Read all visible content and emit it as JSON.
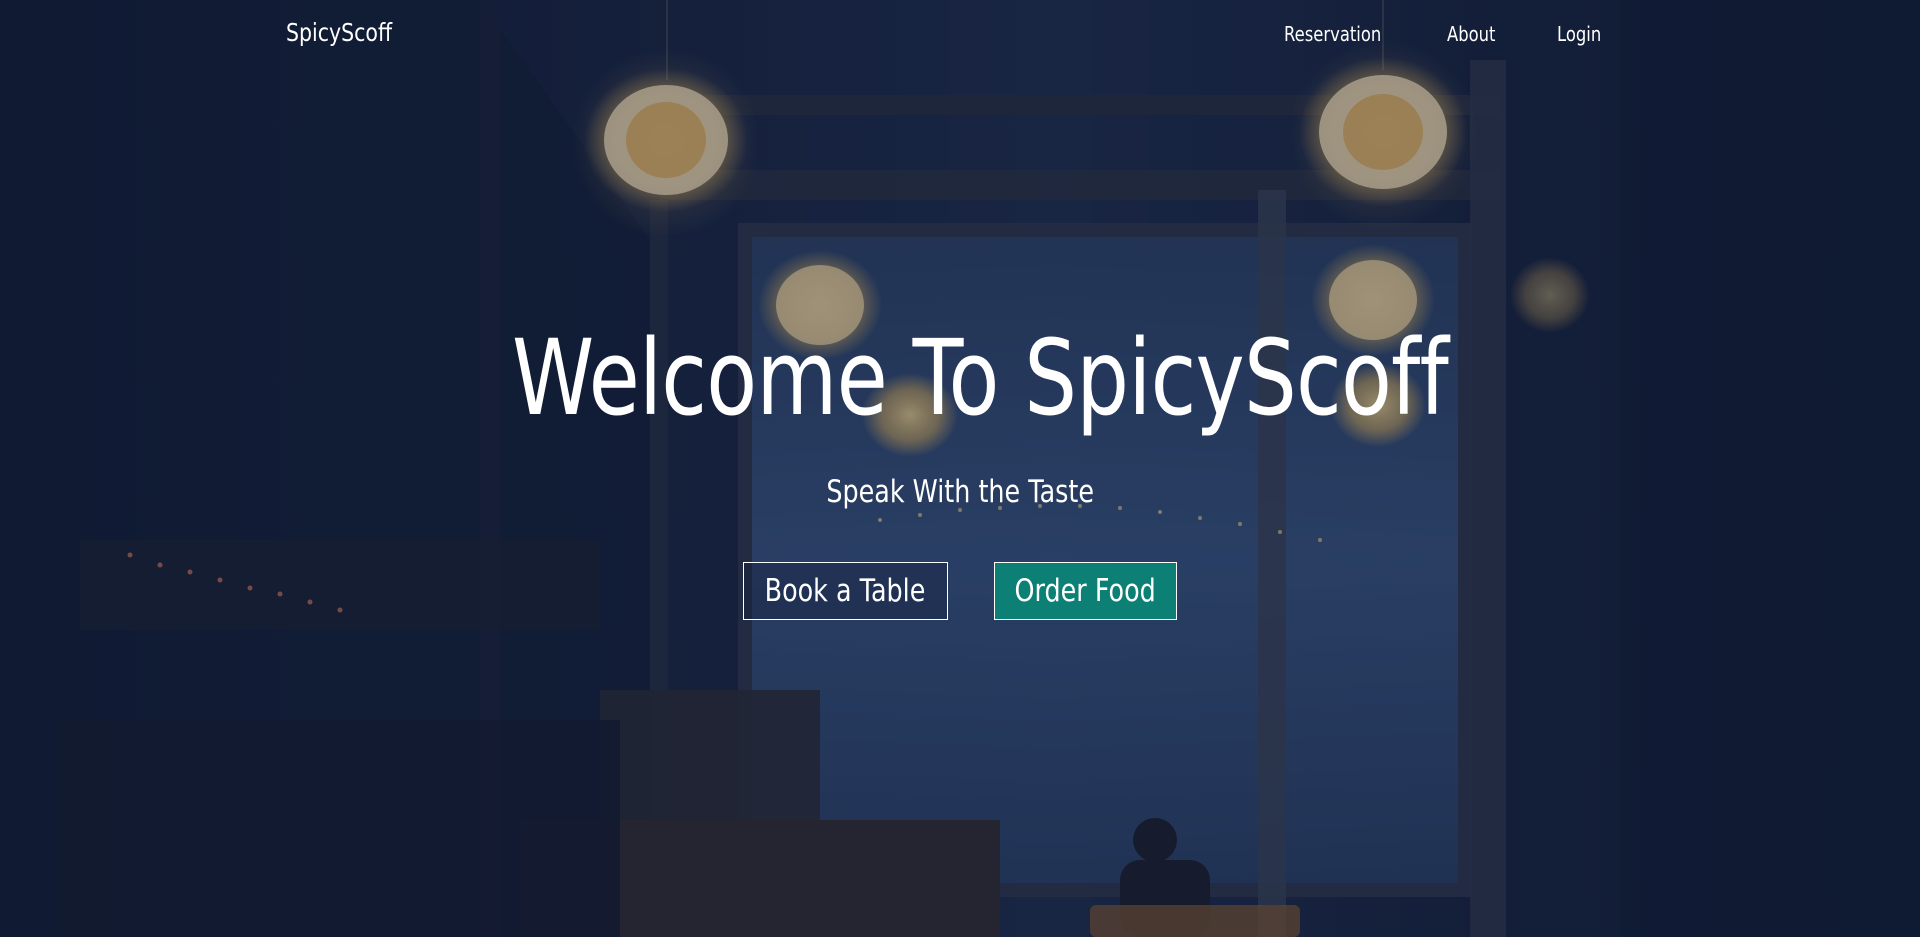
{
  "nav": {
    "brand": "SpicyScoff",
    "links": [
      {
        "label": "Reservation"
      },
      {
        "label": "About"
      },
      {
        "label": "Login"
      }
    ]
  },
  "hero": {
    "title": "Welcome To SpicyScoff",
    "subtitle": "Speak With the Taste",
    "buttons": {
      "book": "Book a Table",
      "order": "Order Food"
    }
  },
  "colors": {
    "background": "#141e36",
    "accent": "#0d8076",
    "text": "#ffffff"
  }
}
